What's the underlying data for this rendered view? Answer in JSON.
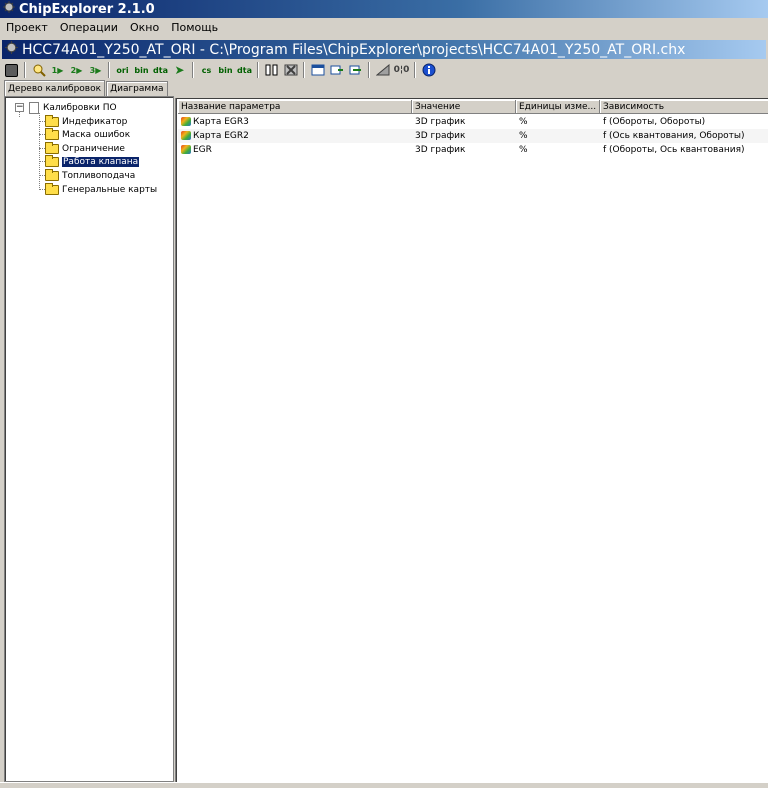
{
  "app": {
    "title": "ChipExplorer 2.1.0"
  },
  "menu": {
    "items": [
      "Проект",
      "Операции",
      "Окно",
      "Помощь"
    ]
  },
  "document": {
    "title": "HCC74A01_Y250_AT_ORI - C:\\Program Files\\ChipExplorer\\projects\\HCC74A01_Y250_AT_ORI.chx"
  },
  "toolbar": {
    "buttons": [
      {
        "icon": "save-icon",
        "label": ""
      },
      {
        "icon": "search-icon",
        "label": ""
      },
      {
        "icon": "step-1-icon",
        "label": "1"
      },
      {
        "icon": "step-2-icon",
        "label": "2"
      },
      {
        "icon": "step-3-icon",
        "label": "3"
      },
      {
        "icon": "ori-icon",
        "label": "ori"
      },
      {
        "icon": "bin-icon",
        "label": "bin"
      },
      {
        "icon": "dta-icon",
        "label": "dta"
      },
      {
        "icon": "arrow-right-icon",
        "label": ""
      },
      {
        "icon": "cs-icon",
        "label": "cs"
      },
      {
        "icon": "bin-icon-2",
        "label": "bin"
      },
      {
        "icon": "dta-icon-2",
        "label": "dta"
      },
      {
        "icon": "columns-icon",
        "label": ""
      },
      {
        "icon": "delete-icon",
        "label": ""
      },
      {
        "icon": "window-icon",
        "label": ""
      },
      {
        "icon": "compare-icon",
        "label": ""
      },
      {
        "icon": "merge-icon",
        "label": ""
      },
      {
        "icon": "triangle-icon",
        "label": ""
      },
      {
        "icon": "hex-icon",
        "label": ""
      },
      {
        "icon": "info-icon",
        "label": ""
      }
    ]
  },
  "tabs": [
    {
      "label": "Дерево калибровок",
      "active": true
    },
    {
      "label": "Диаграмма",
      "active": false
    }
  ],
  "tree": {
    "root": "Калибровки ПО",
    "children": [
      {
        "label": "Индефикатор",
        "selected": false
      },
      {
        "label": "Маска ошибок",
        "selected": false
      },
      {
        "label": "Ограничение",
        "selected": false
      },
      {
        "label": "Работа клапана",
        "selected": true
      },
      {
        "label": "Топливоподача",
        "selected": false
      },
      {
        "label": "Генеральные карты",
        "selected": false
      }
    ]
  },
  "table": {
    "columns": [
      "Название параметра",
      "Значение",
      "Единицы изме...",
      "Зависимость"
    ],
    "rows": [
      {
        "name": "Карта EGR3",
        "value": "3D график",
        "units": "%",
        "dependency": "f (Обороты, Обороты)"
      },
      {
        "name": "Карта EGR2",
        "value": "3D график",
        "units": "%",
        "dependency": "f (Ось квантования, Обороты)"
      },
      {
        "name": "EGR",
        "value": "3D график",
        "units": "%",
        "dependency": "f (Обороты, Ось квантования)"
      }
    ]
  },
  "colors": {
    "title_bar": "#0a246a",
    "selection": "#0a246a",
    "face": "#d4d0c8"
  }
}
